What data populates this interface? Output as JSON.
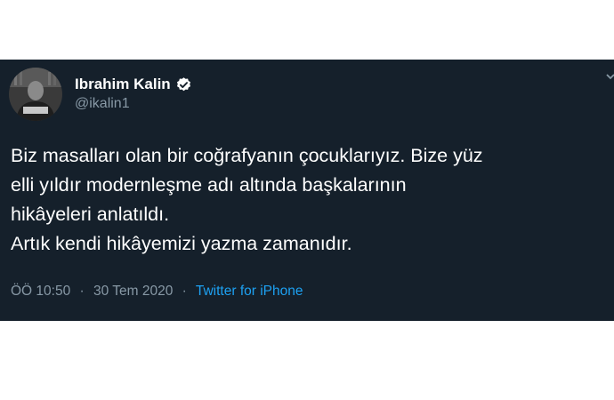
{
  "author": {
    "name": "Ibrahim Kalin",
    "handle": "@ikalin1"
  },
  "tweet": {
    "lines": [
      "Biz masalları olan bir coğrafyanın çocuklarıyız. Bize yüz",
      "elli yıldır modernleşme adı altında başkalarının",
      "hikâyeleri anlatıldı.",
      "Artık kendi hikâyemizi yazma zamanıdır."
    ]
  },
  "meta": {
    "time": "ÖÖ 10:50",
    "separator": "·",
    "date": "30 Tem 2020",
    "source": "Twitter for iPhone"
  },
  "colors": {
    "background": "#15202b",
    "secondary_text": "#8899a6",
    "link": "#1da1f2",
    "verified": "#ffffff"
  },
  "icons": {
    "verified": "verified-badge-icon",
    "more": "chevron-down-icon"
  }
}
